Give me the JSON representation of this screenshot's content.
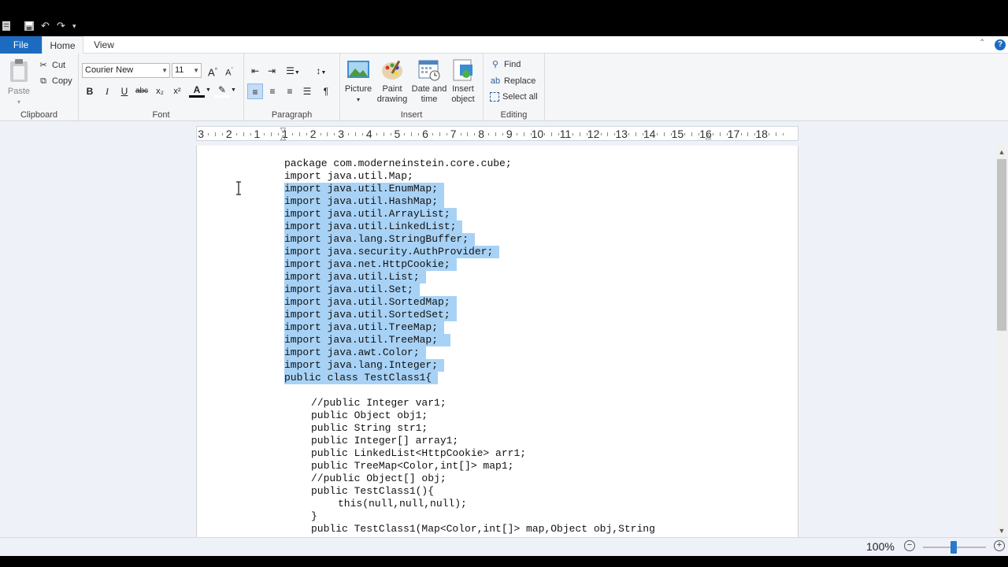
{
  "colors": {
    "accent": "#1c6bc0",
    "selection": "#a8d2f5",
    "titlebar": "#000000"
  },
  "tabs": {
    "file": "File",
    "home": "Home",
    "view": "View"
  },
  "clipboard": {
    "paste": "Paste",
    "cut": "Cut",
    "copy": "Copy",
    "group": "Clipboard"
  },
  "font": {
    "family": "Courier New",
    "size": "11",
    "group": "Font",
    "bold": "B",
    "italic": "I",
    "underline": "U",
    "strike": "abc",
    "sub": "x₂",
    "sup": "x²",
    "grow": "A",
    "shrink": "A",
    "color": "A"
  },
  "paragraph": {
    "group": "Paragraph"
  },
  "insert": {
    "picture": "Picture",
    "paint1": "Paint",
    "paint2": "drawing",
    "date1": "Date and",
    "date2": "time",
    "obj1": "Insert",
    "obj2": "object",
    "group": "Insert"
  },
  "editing": {
    "find": "Find",
    "replace": "Replace",
    "selectall": "Select all",
    "group": "Editing"
  },
  "ruler": [
    "3",
    "2",
    "1",
    "1",
    "2",
    "3",
    "4",
    "5",
    "6",
    "7",
    "8",
    "9",
    "10",
    "11",
    "12",
    "13",
    "14",
    "15",
    "16",
    "17",
    "18"
  ],
  "code": {
    "l1": "package com.moderneinstein.core.cube;",
    "l2": "import java.util.Map;",
    "l3": "import java.util.EnumMap;",
    "l4": "import java.util.HashMap;",
    "l5": "import java.util.ArrayList;",
    "l6": "import java.util.LinkedList;",
    "l7": "import java.lang.StringBuffer;",
    "l8": "import java.security.AuthProvider;",
    "l9": "import java.net.HttpCookie;",
    "l10": "import java.util.List;",
    "l11": "import java.util.Set;",
    "l12": "import java.util.SortedMap;",
    "l13": "import java.util.SortedSet;",
    "l14": "import java.util.TreeMap;",
    "l15": "import java.util.TreeMap;",
    "l16": "import java.awt.Color;",
    "l17": "import java.lang.Integer;",
    "l18": "public class TestClass1{",
    "l19": "//public Integer var1;",
    "l20": "public Object obj1;",
    "l21": "public String str1;",
    "l22": "public Integer[] array1;",
    "l23": "public LinkedList<HttpCookie> arr1;",
    "l24": "public TreeMap<Color,int[]> map1;",
    "l25": "//public Object[] obj;",
    "l26": "public TestClass1(){",
    "l27": "this(null,null,null);",
    "l28": "}",
    "l29": "public TestClass1(Map<Color,int[]> map,Object obj,String"
  },
  "status": {
    "zoom": "100%",
    "minus": "−",
    "plus": "+"
  }
}
